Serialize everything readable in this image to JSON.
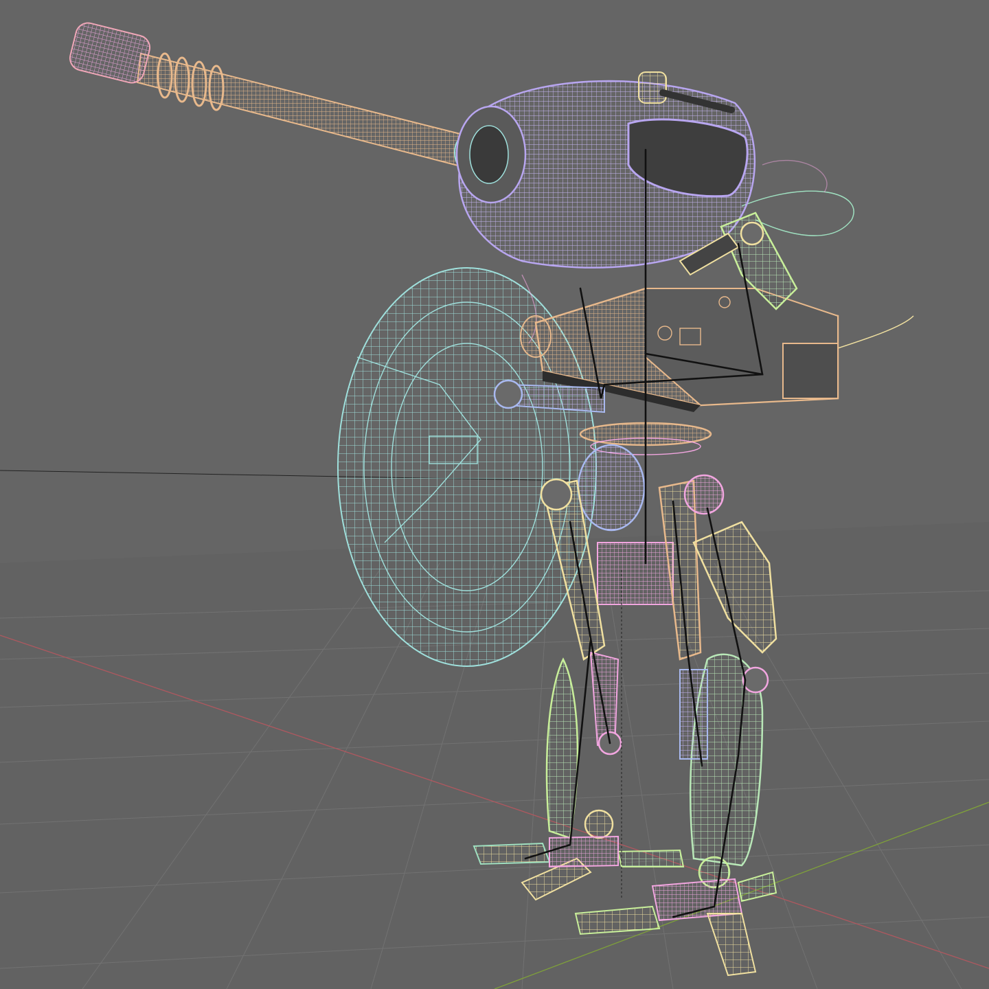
{
  "viewport": {
    "mode": "wireframe",
    "background": "#656565",
    "grid_color": "#7a7a7a",
    "x_axis_color": "#b0585f",
    "y_axis_color": "#7fa13a"
  },
  "palette": {
    "barrel": "#e8b98c",
    "muzzle": "#f0a7b8",
    "head": "#b8a6f0",
    "shield": "#9fe0dc",
    "cables": "#9fe0c0",
    "pink_parts": "#f2a6e0",
    "yellow_parts": "#f0e0a0",
    "blue_parts": "#a9b9f0",
    "green_parts": "#c8ef9a",
    "armature": "#111111"
  },
  "icons": {
    "model": "mech-walker-wireframe",
    "armature": "armature-bones"
  }
}
